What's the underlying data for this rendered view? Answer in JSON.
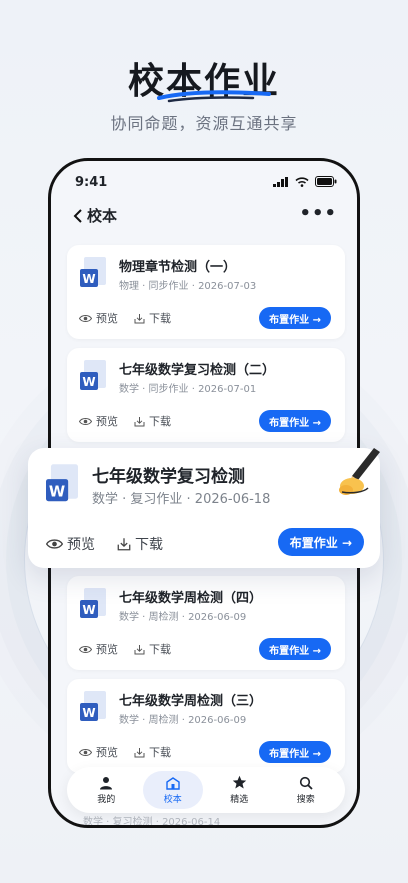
{
  "hero": {
    "title": "校本作业",
    "subtitle": "协同命题，资源互通共享"
  },
  "status_bar": {
    "time": "9:41"
  },
  "nav": {
    "back_label": "校本",
    "more_label": "•••"
  },
  "card_actions": {
    "preview": "预览",
    "download": "下载",
    "assign": "布置作业 →"
  },
  "doc_icon_letter": "W",
  "cards": [
    {
      "title": "物理章节检测（一）",
      "meta": "物理 · 同步作业 · 2026-07-03"
    },
    {
      "title": "七年级数学复习检测（二）",
      "meta": "数学 · 同步作业 · 2026-07-01"
    },
    {
      "title": "七年级数学周检测（四）",
      "meta": "数学 · 周检测 · 2026-06-09"
    },
    {
      "title": "七年级数学周检测（三）",
      "meta": "数学 · 周检测 · 2026-06-09"
    }
  ],
  "featured": {
    "title": "七年级数学复习检测",
    "meta": "数学 · 复习作业 · 2026-06-18"
  },
  "tabs": [
    {
      "label": "我的",
      "icon": "person-icon"
    },
    {
      "label": "校本",
      "icon": "building-icon"
    },
    {
      "label": "精选",
      "icon": "star-icon"
    },
    {
      "label": "搜索",
      "icon": "search-icon"
    }
  ],
  "peek_row": "数学 · 复习检测 · 2026-06-14",
  "colors": {
    "accent": "#1769f4",
    "doc_blue": "#2f5dbe"
  }
}
